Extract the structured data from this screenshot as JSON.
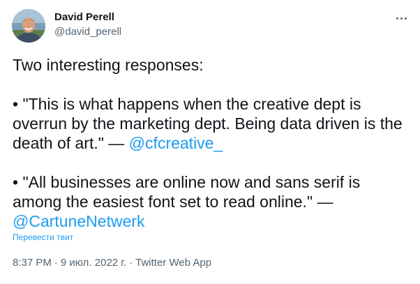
{
  "author": {
    "name": "David Perell",
    "handle": "@david_perell"
  },
  "tweet": {
    "intro": "Two interesting responses:",
    "quote1_line1": "• \"This is what happens when the creative dept is",
    "quote1_line2": "overrun by the marketing dept. Being data driven is the",
    "quote1_line3": "death of art.\" — ",
    "quote1_mention": "@cfcreative_",
    "quote2_line1": "• \"All businesses are online now and sans serif is",
    "quote2_line2": "among the easiest font set to read online.\" —",
    "quote2_mention": "@CartuneNetwerk"
  },
  "translate_label": "Перевести твит",
  "meta": {
    "time": "8:37 PM",
    "separator": "·",
    "date": "9 июл. 2022 г.",
    "app": "Twitter Web App"
  },
  "colors": {
    "text": "#0f1419",
    "secondary": "#536471",
    "link": "#1d9bf0"
  },
  "icons": {
    "more": "more-horizontal-icon"
  }
}
